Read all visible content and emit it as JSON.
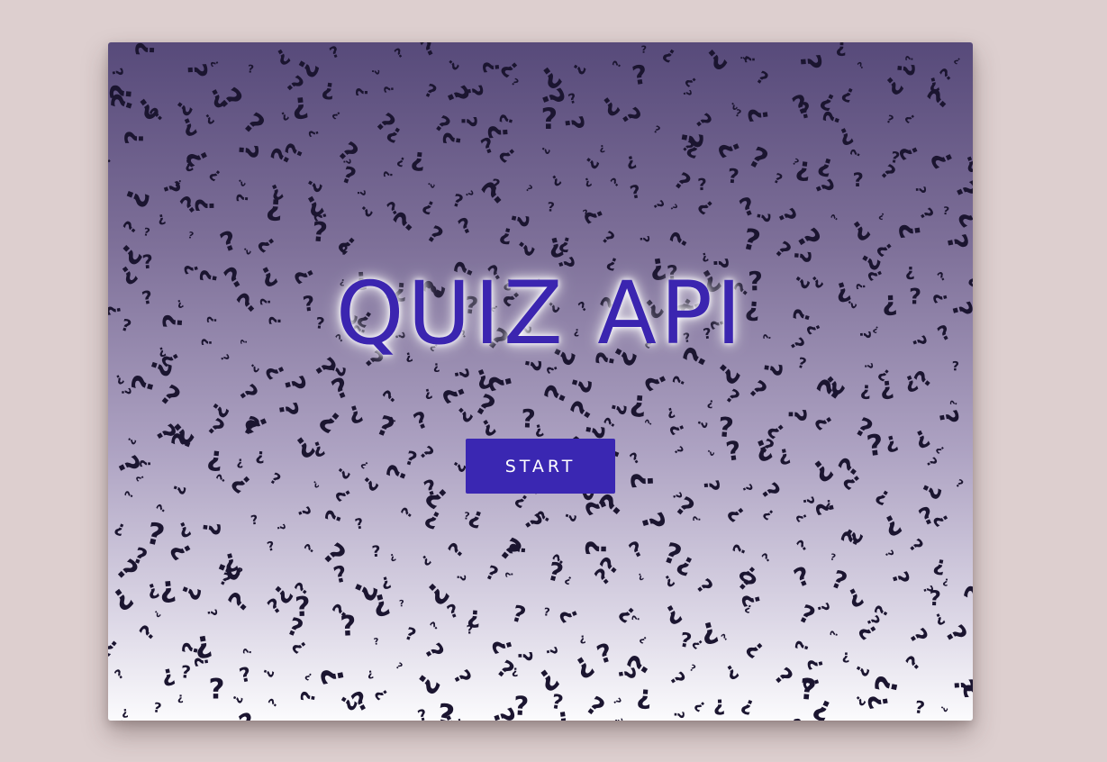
{
  "app": {
    "title": "QUIZ API"
  },
  "actions": {
    "start_label": "START"
  },
  "background": {
    "pattern_glyphs": [
      "?",
      "¿"
    ],
    "colors": {
      "page": "#ddcfcf",
      "gradient_top": "#574a7a",
      "gradient_bottom": "#fbfbfd",
      "glyph": "#1b1530"
    }
  },
  "colors": {
    "title": "#3b25b0",
    "button": "#3a27b2",
    "button_text": "#ffffff"
  }
}
